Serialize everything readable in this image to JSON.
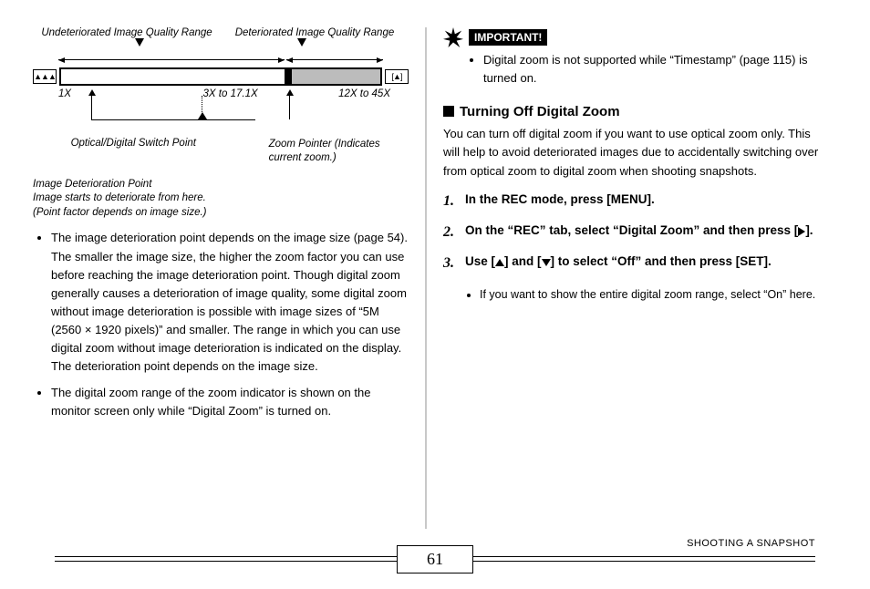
{
  "diagram": {
    "top_left_label": "Undeteriorated Image Quality Range",
    "top_right_label": "Deteriorated Image Quality Range",
    "left_icon": "wide-zoom-icon",
    "right_icon": "tele-zoom-icon",
    "tick_1x": "1X",
    "tick_mid": "3X to 17.1X",
    "tick_max": "12X to 45X",
    "switch_point_label": "Optical/Digital Switch Point",
    "zoom_pointer_label": "Zoom Pointer (Indicates current zoom.)",
    "deterioration_label": "Image Deterioration Point\nImage starts to deteriorate from here.\n(Point factor depends on image size.)"
  },
  "left_bullets": [
    "The image deterioration point depends on the image size (page 54). The smaller the image size, the higher the zoom factor you can use before reaching the image deterioration point. Though digital zoom generally causes a deterioration of image quality, some digital zoom without image deterioration is possible with image sizes of “5M (2560 × 1920 pixels)” and smaller. The range in which you can use digital zoom without image deterioration is indicated on the display. The deterioration point depends on the image size.",
    "The digital zoom range of the zoom indicator is shown on the monitor screen only while “Digital Zoom” is turned on."
  ],
  "important": {
    "label": "IMPORTANT!",
    "bullet": "Digital zoom is not supported while “Timestamp” (page 115) is turned on."
  },
  "section_title": "Turning Off Digital Zoom",
  "intro": "You can turn off digital zoom if you want to use optical zoom only. This will help to avoid deteriorated images due to accidentally switching over from optical zoom to digital zoom when shooting snapshots.",
  "steps": [
    {
      "num": "1.",
      "text_before": "In the REC mode, press [MENU].",
      "has_icons": false
    },
    {
      "num": "2.",
      "text_before": "On the “REC” tab, select “Digital Zoom” and then press [",
      "icons": [
        "right"
      ],
      "text_after": "]."
    },
    {
      "num": "3.",
      "text_before": "Use [",
      "icons": [
        "up"
      ],
      "text_mid": "] and [",
      "icons2": [
        "down"
      ],
      "text_after": "] to select “Off” and then press [SET]."
    }
  ],
  "step3_sub": "If you want to show the entire digital zoom range, select “On” here.",
  "footer": {
    "page_num": "61",
    "caption": "SHOOTING A SNAPSHOT"
  }
}
